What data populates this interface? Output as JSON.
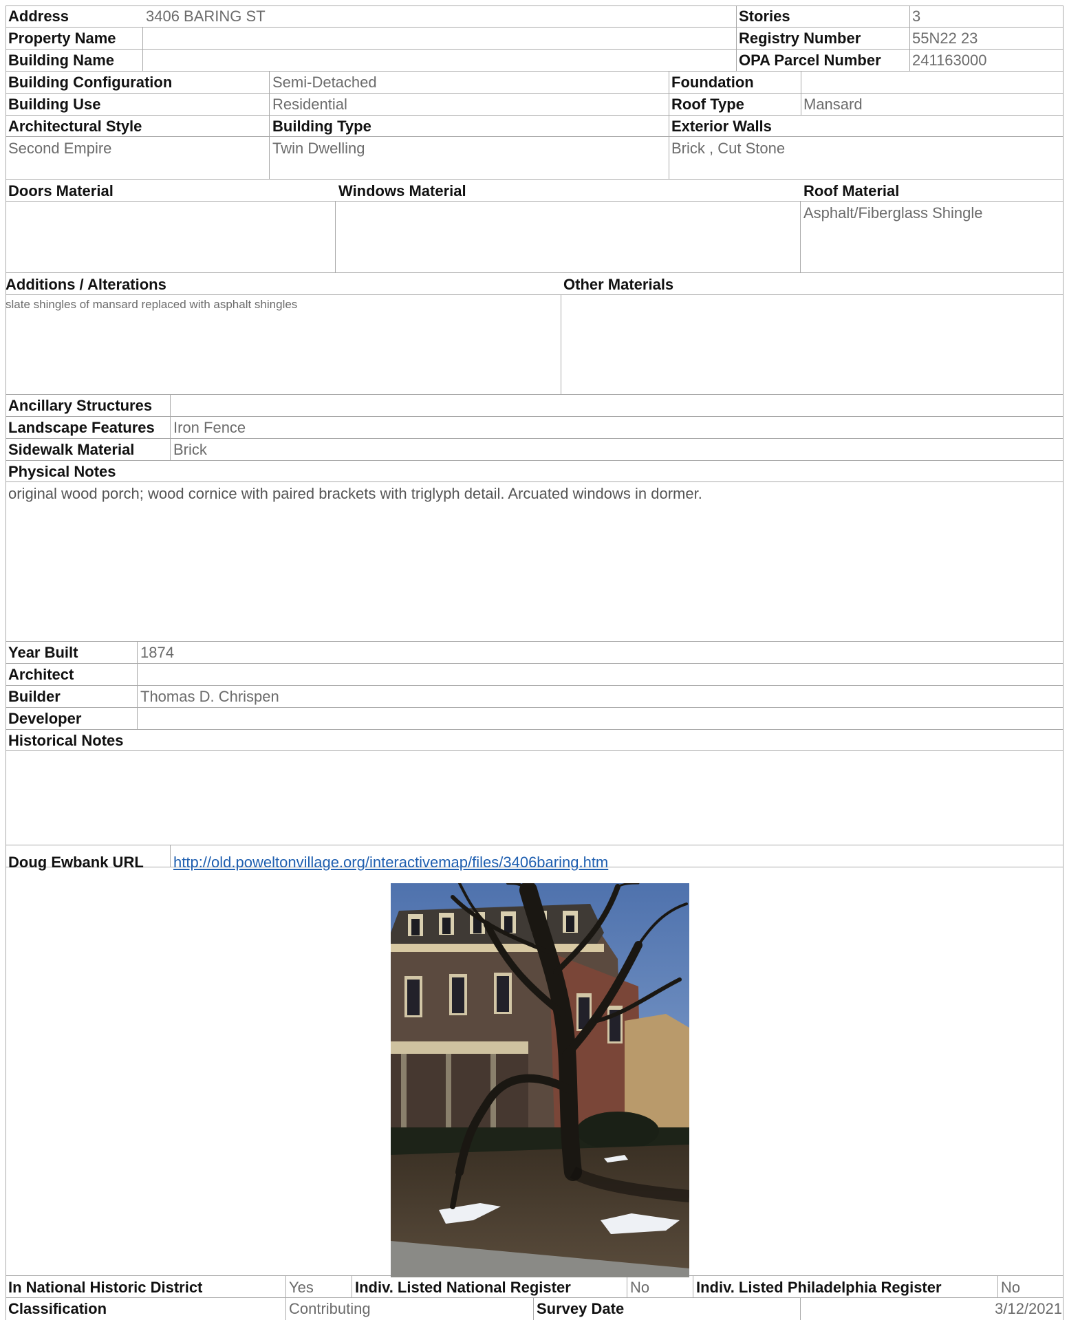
{
  "address": {
    "label": "Address",
    "value": "3406 BARING ST"
  },
  "stories": {
    "label": "Stories",
    "value": "3"
  },
  "property_name": {
    "label": "Property Name",
    "value": ""
  },
  "registry_number": {
    "label": "Registry Number",
    "value": "55N22 23"
  },
  "building_name": {
    "label": "Building Name",
    "value": ""
  },
  "opa_parcel": {
    "label": "OPA Parcel Number",
    "value": "241163000"
  },
  "building_configuration": {
    "label": "Building Configuration",
    "value": "Semi-Detached"
  },
  "foundation": {
    "label": "Foundation",
    "value": ""
  },
  "building_use": {
    "label": "Building Use",
    "value": "Residential"
  },
  "roof_type": {
    "label": "Roof Type",
    "value": "Mansard"
  },
  "architectural_style": {
    "label": "Architectural Style",
    "value": "Second Empire"
  },
  "building_type": {
    "label": "Building Type",
    "value": "Twin Dwelling"
  },
  "exterior_walls": {
    "label": "Exterior Walls",
    "value": "Brick , Cut Stone"
  },
  "doors_material": {
    "label": "Doors Material",
    "value": ""
  },
  "windows_material": {
    "label": "Windows Material",
    "value": ""
  },
  "roof_material": {
    "label": "Roof Material",
    "value": "Asphalt/Fiberglass Shingle"
  },
  "additions": {
    "label": "Additions / Alterations",
    "value": "slate shingles of mansard replaced with asphalt shingles"
  },
  "other_materials": {
    "label": "Other Materials",
    "value": ""
  },
  "ancillary_structures": {
    "label": "Ancillary Structures",
    "value": ""
  },
  "landscape_features": {
    "label": "Landscape Features",
    "value": "Iron Fence"
  },
  "sidewalk_material": {
    "label": "Sidewalk Material",
    "value": "Brick"
  },
  "physical_notes": {
    "label": "Physical Notes",
    "value": "original wood porch; wood cornice with paired brackets with triglyph detail. Arcuated windows in dormer."
  },
  "year_built": {
    "label": "Year Built",
    "value": "1874"
  },
  "architect": {
    "label": "Architect",
    "value": ""
  },
  "builder": {
    "label": "Builder",
    "value": "Thomas D. Chrispen"
  },
  "developer": {
    "label": "Developer",
    "value": ""
  },
  "historical_notes": {
    "label": "Historical Notes",
    "value": ""
  },
  "doug_ewbank": {
    "label": "Doug Ewbank URL",
    "value": "http://old.poweltonvillage.org/interactivemap/files/3406baring.htm"
  },
  "national_district": {
    "label": "In National Historic District",
    "value": "Yes"
  },
  "national_register": {
    "label": "Indiv. Listed National Register",
    "value": "No"
  },
  "philadelphia_register": {
    "label": "Indiv. Listed Philadelphia Register",
    "value": "No"
  },
  "classification": {
    "label": "Classification",
    "value": "Contributing"
  },
  "survey_date": {
    "label": "Survey Date",
    "value": "3/12/2021"
  }
}
